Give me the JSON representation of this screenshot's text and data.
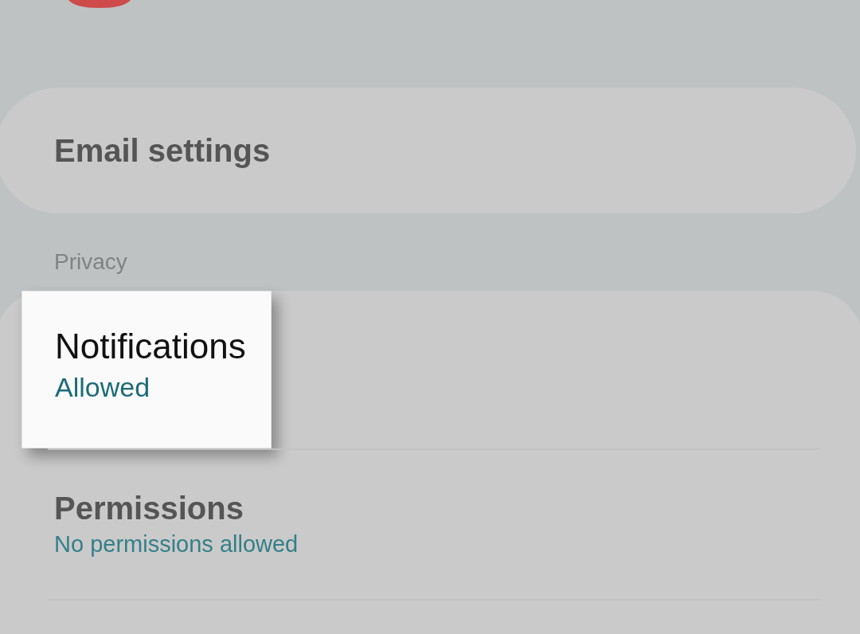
{
  "sections": [
    {
      "items": [
        {
          "title": "Email settings",
          "highlighted": false
        }
      ]
    },
    {
      "header": "Privacy",
      "items": [
        {
          "title": "Notifications",
          "subtitle": "Allowed",
          "highlighted": true
        },
        {
          "title": "Permissions",
          "subtitle": "No permissions allowed",
          "highlighted": false
        }
      ]
    }
  ]
}
